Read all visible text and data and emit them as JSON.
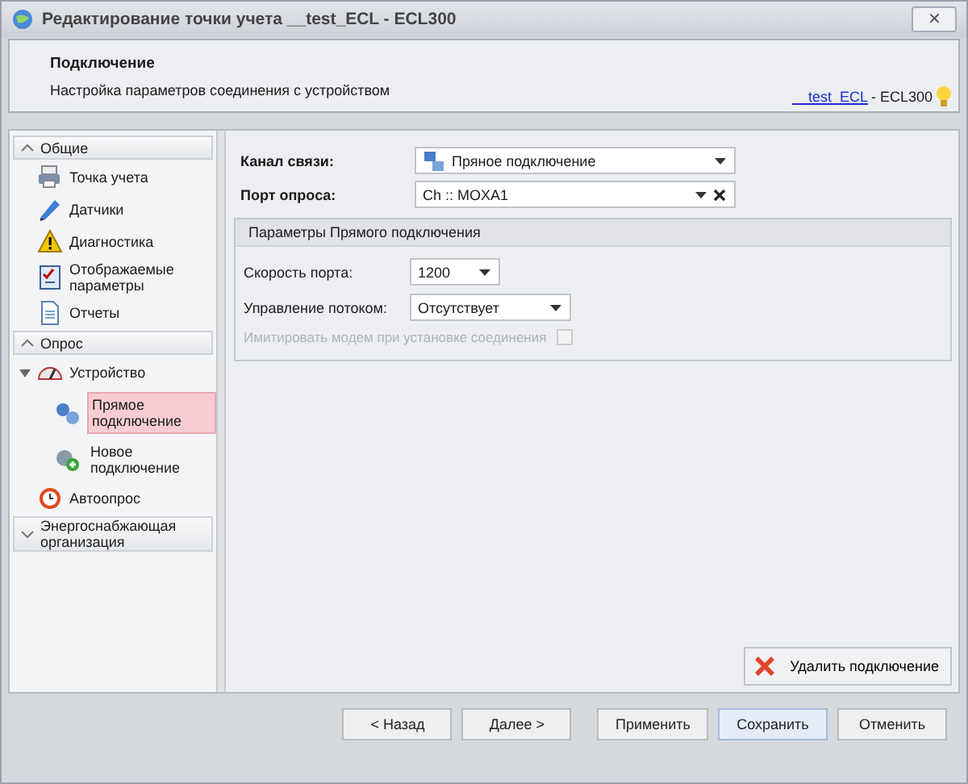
{
  "window": {
    "title": "Редактирование точки учета __test_ECL - ECL300",
    "close": "✕"
  },
  "header": {
    "title": "Подключение",
    "subtitle": "Настройка параметров соединения с устройством",
    "link": "__test_ECL",
    "suffix": " - ECL300"
  },
  "sidebar": {
    "sections": [
      {
        "title": "Общие",
        "expanded": true,
        "items": [
          {
            "label": "Точка учета",
            "selected": false
          },
          {
            "label": "Датчики",
            "selected": false
          },
          {
            "label": "Диагностика",
            "selected": false
          },
          {
            "label": "Отображаемые параметры",
            "selected": false
          },
          {
            "label": "Отчеты",
            "selected": false
          }
        ]
      },
      {
        "title": "Опрос",
        "expanded": true,
        "items": [
          {
            "label": "Устройство",
            "selected": false,
            "expanded": true,
            "children": [
              {
                "label": "Прямое подключение",
                "selected": true
              },
              {
                "label": "Новое подключение",
                "selected": false
              }
            ]
          },
          {
            "label": "Автоопрос",
            "selected": false
          }
        ]
      },
      {
        "title": "Энергоснабжающая организация",
        "expanded": false
      }
    ]
  },
  "fields": [
    {
      "label": "Канал связи:",
      "value": "Пряное подключение",
      "kind": "icon-combo"
    },
    {
      "label": "Порт опроса:",
      "value": "Ch :: MOXA1",
      "kind": "clear-combo"
    }
  ],
  "group": {
    "title": "Параметры Прямого подключения",
    "fields": [
      {
        "label": "Скорость порта:",
        "value": "1200",
        "kind": "short-combo"
      },
      {
        "label": "Управление потоком:",
        "value": "Отсутствует",
        "kind": "mid-combo"
      }
    ],
    "checkbox": {
      "label": "Имитировать модем при установке соединения",
      "checked": false,
      "disabled": true
    }
  },
  "delete_button": "Удалить подключение",
  "buttons": [
    {
      "label": "< Назад",
      "default": false
    },
    {
      "label": "Далее >",
      "default": false
    },
    {
      "label": "Применить",
      "default": false
    },
    {
      "label": "Сохранить",
      "default": true
    },
    {
      "label": "Отменить",
      "default": false
    }
  ]
}
